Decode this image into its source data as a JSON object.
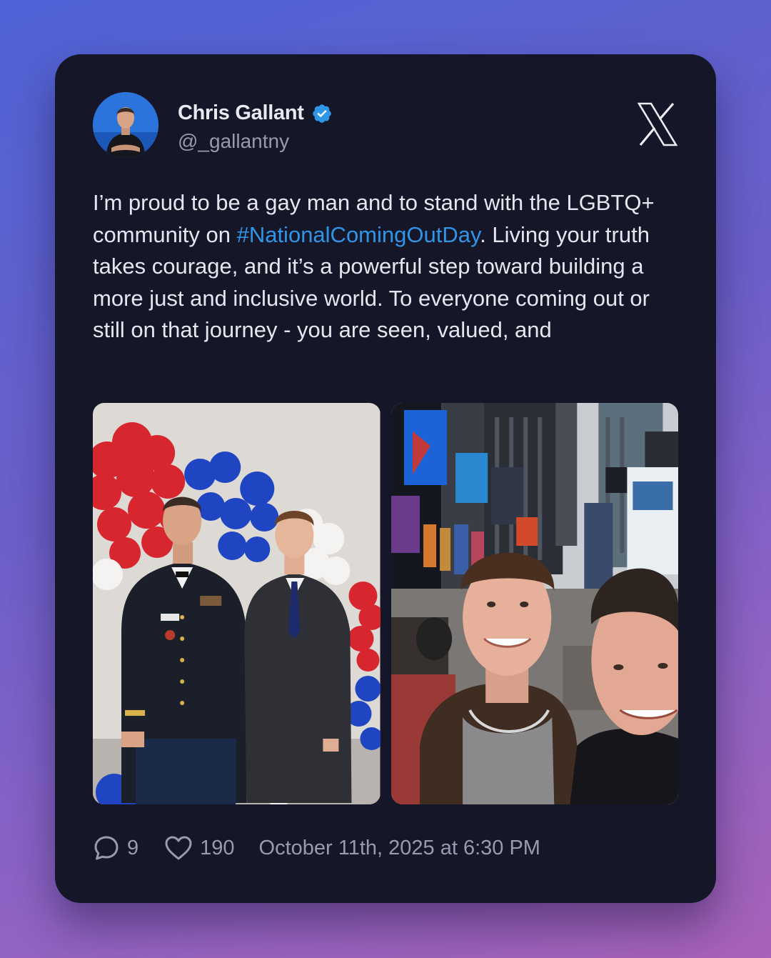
{
  "author": {
    "display_name": "Chris Gallant",
    "handle": "@_gallantny",
    "verified": true
  },
  "tweet": {
    "text_before_hashtag": "I’m proud to be a gay man and to stand with the LGBTQ+ community on ",
    "hashtag": "#NationalComingOutDay",
    "text_after_hashtag": ". Living your truth takes courage, and it’s a powerful step toward building a more just and inclusive world. To everyone coming out or still on that journey - you are seen, valued, and"
  },
  "stats": {
    "replies": "9",
    "likes": "190",
    "timestamp": "October 11th, 2025 at 6:30 PM"
  },
  "colors": {
    "card_background": "#161629",
    "hashtag": "#2f95e6",
    "verified_badge": "#2f95e6",
    "muted_text": "#9a9aae"
  },
  "icons": {
    "platform": "x-logo-icon",
    "verified": "verified-badge-icon",
    "replies": "comment-icon",
    "likes": "heart-icon"
  }
}
